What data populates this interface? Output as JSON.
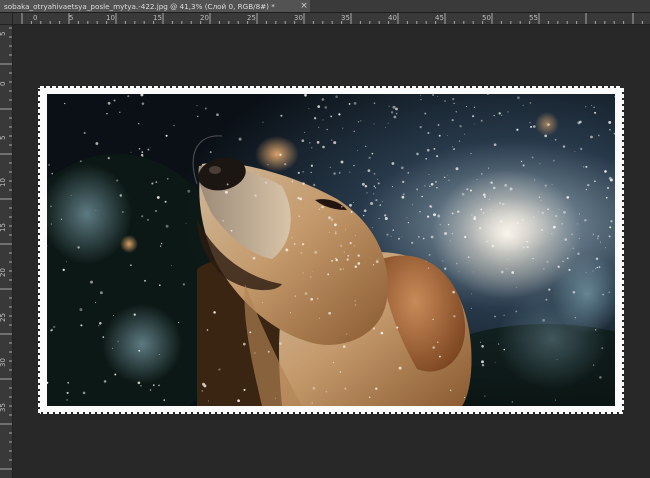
{
  "document_tab": {
    "title": "sobaka_otryahivaetsya_posle_mytya.-422.jpg @ 41,3% (Слой 0, RGB/8#) *",
    "close_glyph": "×"
  },
  "ruler_horizontal": {
    "labels": [
      "0",
      "5",
      "10",
      "15",
      "20",
      "25",
      "30",
      "35",
      "40",
      "45",
      "50",
      "55"
    ]
  },
  "ruler_vertical": {
    "labels": [
      "5",
      "0",
      "5",
      "10",
      "15",
      "20",
      "25",
      "30",
      "35"
    ]
  },
  "colors": {
    "workspace": "#282828",
    "ruler": "#393939",
    "tab_active": "#535353",
    "frame": "#fbfbfb"
  }
}
